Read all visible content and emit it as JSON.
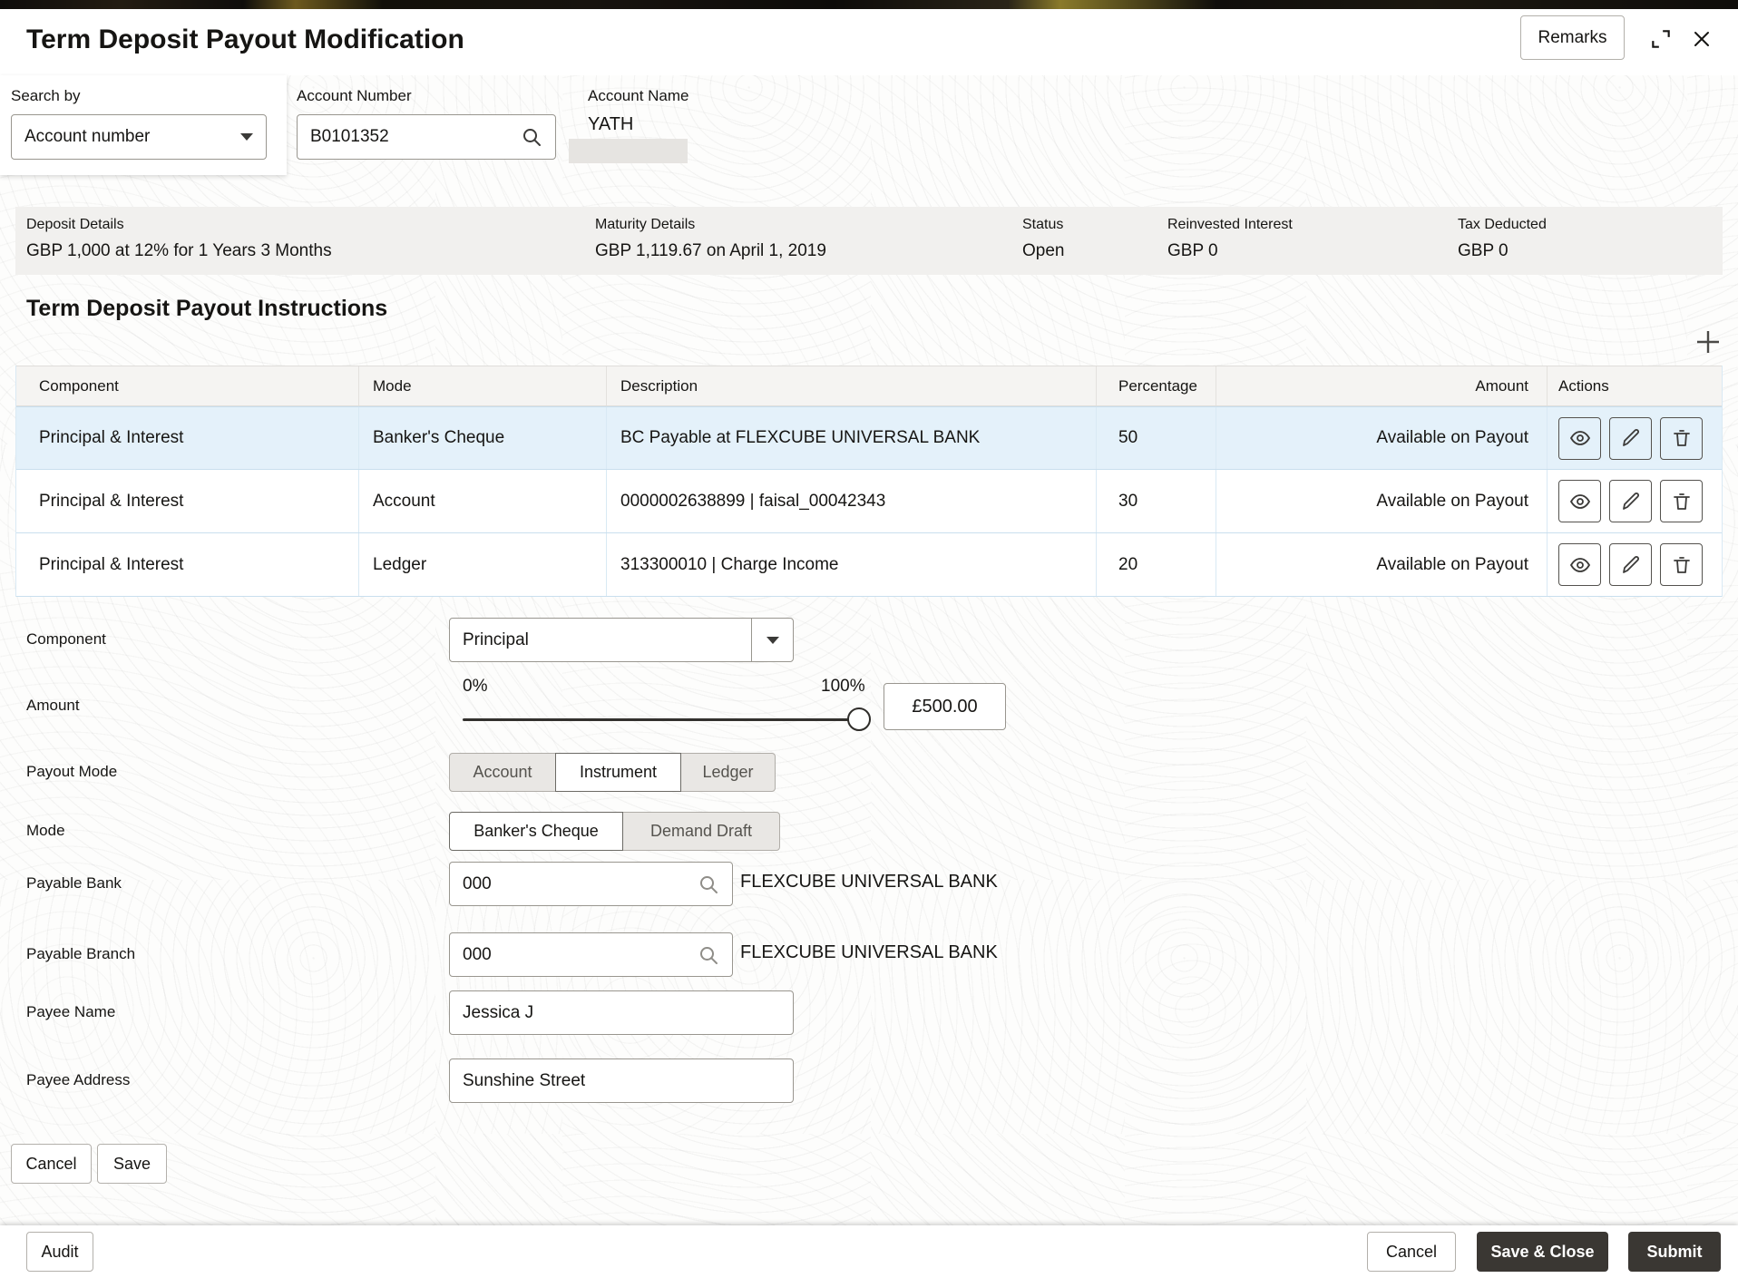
{
  "colors": {
    "primary-btn": "#3A3733",
    "row-highlight": "#E4F1FA"
  },
  "header": {
    "title": "Term Deposit Payout Modification",
    "remarks_label": "Remarks"
  },
  "search": {
    "search_by_label": "Search by",
    "search_by_value": "Account number",
    "account_number_label": "Account Number",
    "account_number_value": "B0101352",
    "account_name_label": "Account Name",
    "account_name_value": "YATH"
  },
  "summary": {
    "items": [
      {
        "label": "Deposit Details",
        "value": "GBP 1,000 at 12% for 1 Years 3 Months"
      },
      {
        "label": "Maturity Details",
        "value": "GBP 1,119.67 on April 1, 2019"
      },
      {
        "label": "Status",
        "value": "Open"
      },
      {
        "label": "Reinvested Interest",
        "value": "GBP 0"
      },
      {
        "label": "Tax Deducted",
        "value": "GBP 0"
      }
    ]
  },
  "instructions": {
    "title": "Term Deposit Payout Instructions",
    "table": {
      "headers": [
        "Component",
        "Mode",
        "Description",
        "Percentage",
        "Amount",
        "Actions"
      ],
      "rows": [
        {
          "component": "Principal & Interest",
          "mode": "Banker's Cheque",
          "description": "BC Payable at FLEXCUBE UNIVERSAL BANK",
          "percentage": "50",
          "amount": "Available on Payout"
        },
        {
          "component": "Principal & Interest",
          "mode": "Account",
          "description": "0000002638899 | faisal_00042343",
          "percentage": "30",
          "amount": "Available on Payout"
        },
        {
          "component": "Principal & Interest",
          "mode": "Ledger",
          "description": "313300010 | Charge Income",
          "percentage": "20",
          "amount": "Available on Payout"
        }
      ]
    }
  },
  "form": {
    "component_label": "Component",
    "component_value": "Principal",
    "amount_label": "Amount",
    "slider_min_label": "0%",
    "slider_max_label": "100%",
    "amount_value": "£500.00",
    "payout_mode_label": "Payout Mode",
    "payout_modes": [
      "Account",
      "Instrument",
      "Ledger"
    ],
    "payout_mode_selected": "Instrument",
    "mode_label": "Mode",
    "modes": [
      "Banker's Cheque",
      "Demand Draft"
    ],
    "mode_selected": "Banker's Cheque",
    "payable_bank_label": "Payable Bank",
    "payable_bank_value": "000",
    "payable_bank_name": "FLEXCUBE UNIVERSAL BANK",
    "payable_branch_label": "Payable Branch",
    "payable_branch_value": "000",
    "payable_branch_name": "FLEXCUBE UNIVERSAL BANK",
    "payee_name_label": "Payee Name",
    "payee_name_value": "Jessica J",
    "payee_address_label": "Payee Address",
    "payee_address_value": "Sunshine Street",
    "cancel_label": "Cancel",
    "save_label": "Save"
  },
  "footer": {
    "audit_label": "Audit",
    "cancel_label": "Cancel",
    "save_close_label": "Save & Close",
    "submit_label": "Submit"
  },
  "icons": {
    "search": "magnifier",
    "dropdown": "chevron-down",
    "add": "plus",
    "view": "eye",
    "edit": "pencil",
    "delete": "trash",
    "expand": "expand-corners",
    "close": "x"
  }
}
